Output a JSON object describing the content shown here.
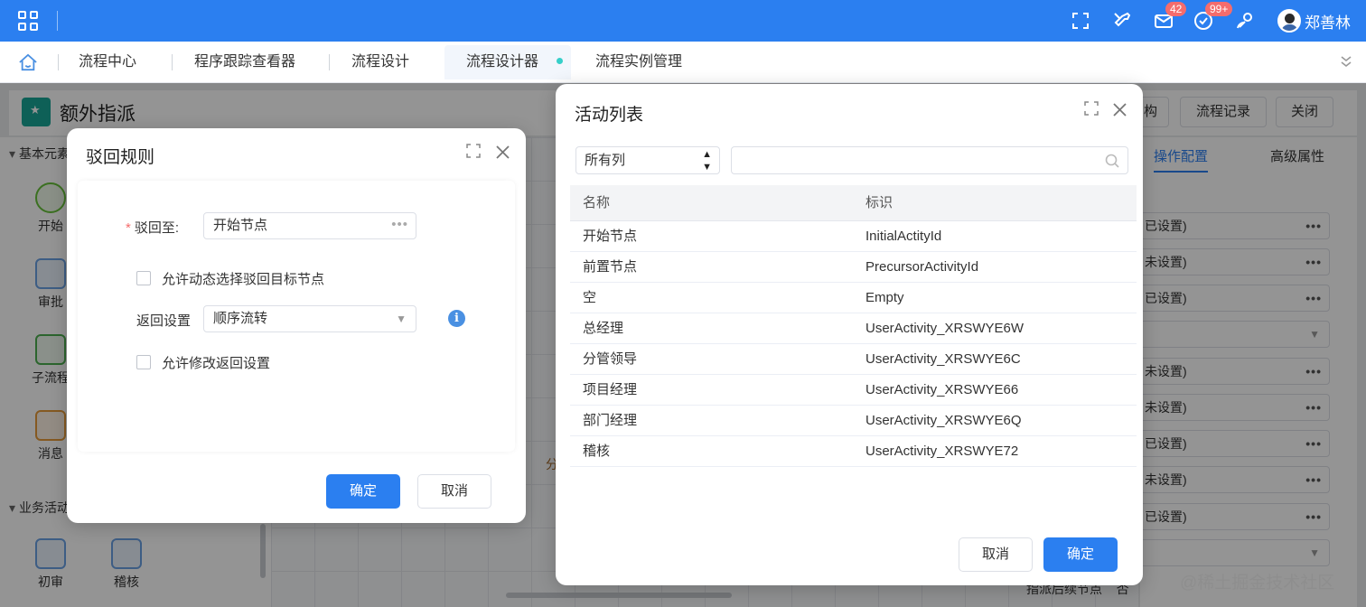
{
  "header": {
    "mail_badge": "42",
    "task_badge": "99+",
    "username": "郑善林"
  },
  "tabs": [
    {
      "label": "流程中心"
    },
    {
      "label": "程序跟踪查看器"
    },
    {
      "label": "流程设计"
    },
    {
      "label": "流程设计器"
    },
    {
      "label": "流程实例管理"
    }
  ],
  "page": {
    "title": "额外指派",
    "btn_partial": "构",
    "btn_history": "流程记录",
    "btn_close": "关闭"
  },
  "palette": {
    "group1": "基本元素",
    "items1": [
      "开始",
      "审批",
      "子流程",
      "消息"
    ],
    "group2": "业务活动",
    "items2": [
      "初审",
      "稽核"
    ]
  },
  "canvas": {
    "node_partial": "分"
  },
  "props": {
    "tab_ops": "操作配置",
    "tab_adv": "高级属性",
    "rows": [
      "已设置)",
      "未设置)",
      "已设置)",
      "",
      "未设置)",
      "未设置)",
      "已设置)",
      "未设置)",
      "已设置)",
      ""
    ],
    "bottom_label": "指派后续节点",
    "bottom_value": "否"
  },
  "dialog_reject": {
    "title": "驳回规则",
    "to_label": "驳回至:",
    "to_value": "开始节点",
    "dyn_select_label": "允许动态选择驳回目标节点",
    "return_label": "返回设置",
    "return_value": "顺序流转",
    "allow_modify_label": "允许修改返回设置",
    "ok": "确定",
    "cancel": "取消"
  },
  "dialog_activities": {
    "title": "活动列表",
    "column_filter": "所有列",
    "search_placeholder": "",
    "columns": [
      "名称",
      "标识"
    ],
    "rows": [
      {
        "name": "开始节点",
        "id": "InitialActityId"
      },
      {
        "name": "前置节点",
        "id": "PrecursorActivityId"
      },
      {
        "name": "空",
        "id": "Empty"
      },
      {
        "name": "总经理",
        "id": "UserActivity_XRSWYE6W"
      },
      {
        "name": "分管领导",
        "id": "UserActivity_XRSWYE6C"
      },
      {
        "name": "项目经理",
        "id": "UserActivity_XRSWYE66"
      },
      {
        "name": "部门经理",
        "id": "UserActivity_XRSWYE6Q"
      },
      {
        "name": "稽核",
        "id": "UserActivity_XRSWYE72"
      }
    ],
    "cancel": "取消",
    "ok": "确定"
  },
  "watermark": "@稀土掘金技术社区"
}
